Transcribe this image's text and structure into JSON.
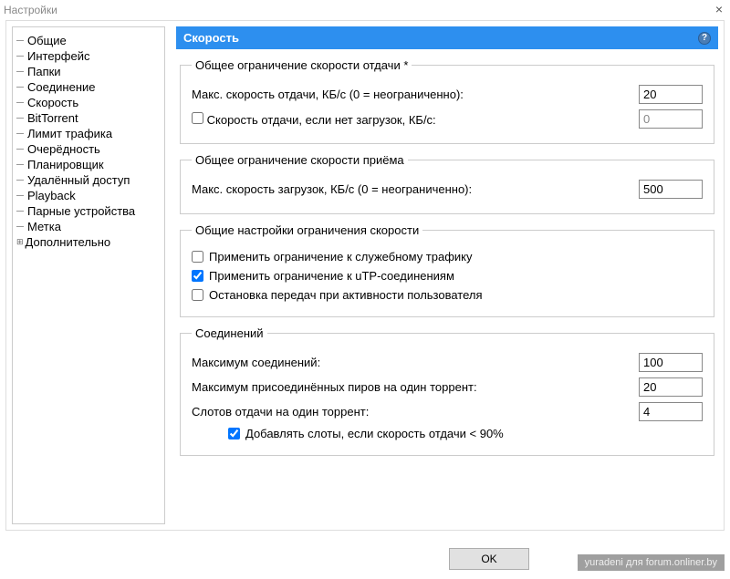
{
  "window": {
    "title": "Настройки"
  },
  "sidebar": {
    "items": [
      {
        "label": "Общие"
      },
      {
        "label": "Интерфейс"
      },
      {
        "label": "Папки"
      },
      {
        "label": "Соединение"
      },
      {
        "label": "Скорость"
      },
      {
        "label": "BitTorrent"
      },
      {
        "label": "Лимит трафика"
      },
      {
        "label": "Очерёдность"
      },
      {
        "label": "Планировщик"
      },
      {
        "label": "Удалённый доступ"
      },
      {
        "label": "Playback"
      },
      {
        "label": "Парные устройства"
      },
      {
        "label": "Метка"
      },
      {
        "label": "Дополнительно"
      }
    ]
  },
  "header": {
    "title": "Скорость",
    "help": "?"
  },
  "upload_limit": {
    "legend": "Общее ограничение скорости отдачи *",
    "max_label": "Макс. скорость отдачи, КБ/с (0 = неограниченно):",
    "max_value": "20",
    "alt_label": "Скорость отдачи, если нет загрузок, КБ/с:",
    "alt_checked": false,
    "alt_value": "0"
  },
  "download_limit": {
    "legend": "Общее ограничение скорости приёма",
    "max_label": "Макс. скорость загрузок, КБ/с (0 = неограниченно):",
    "max_value": "500"
  },
  "rate_settings": {
    "legend": "Общие настройки ограничения скорости",
    "overhead_label": "Применить ограничение к служебному трафику",
    "overhead_checked": false,
    "utp_label": "Применить ограничение к uTP-соединениям",
    "utp_checked": true,
    "stop_label": "Остановка передач при активности пользователя",
    "stop_checked": false
  },
  "connections": {
    "legend": "Соединений",
    "max_conn_label": "Максимум соединений:",
    "max_conn_value": "100",
    "max_peers_label": "Максимум присоединённых пиров на один торрент:",
    "max_peers_value": "20",
    "slots_label": "Слотов отдачи на один торрент:",
    "slots_value": "4",
    "extra_slots_label": "Добавлять слоты, если скорость отдачи < 90%",
    "extra_slots_checked": true
  },
  "footer": {
    "ok": "OK"
  },
  "watermark": "yuradeni для forum.onliner.by"
}
